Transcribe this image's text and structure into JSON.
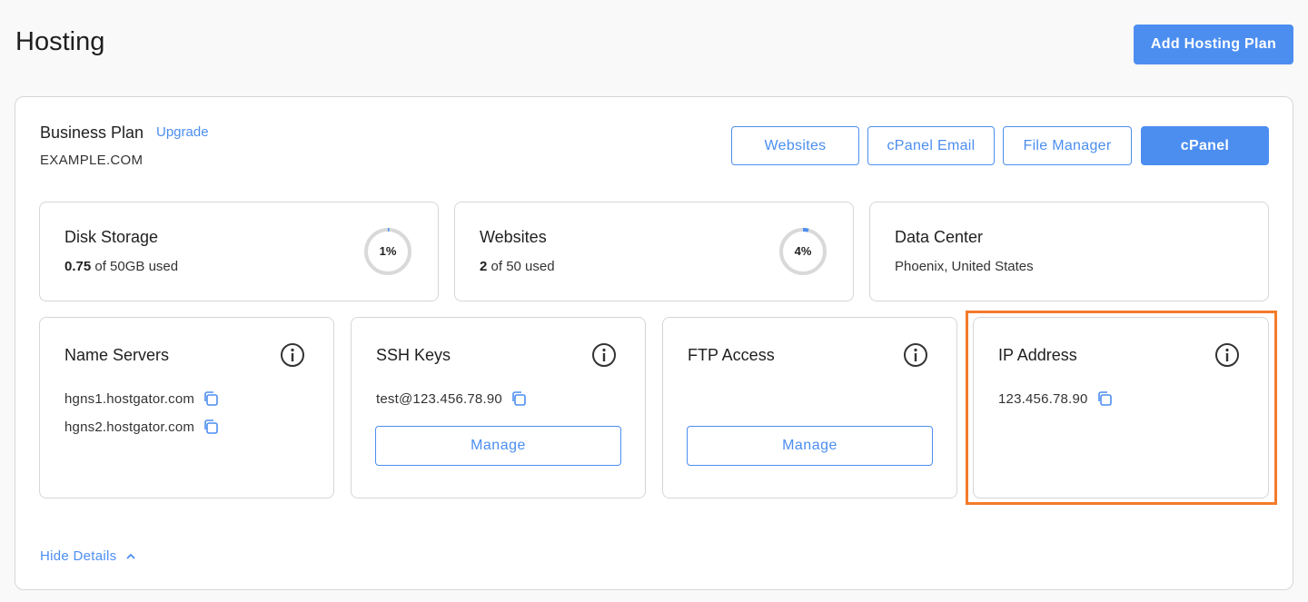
{
  "header": {
    "title": "Hosting",
    "add_button": "Add Hosting Plan"
  },
  "plan": {
    "name": "Business Plan",
    "upgrade": "Upgrade",
    "domain": "EXAMPLE.COM",
    "buttons": {
      "websites": "Websites",
      "cpanel_email": "cPanel Email",
      "file_manager": "File Manager",
      "cpanel": "cPanel"
    }
  },
  "stats": {
    "disk": {
      "title": "Disk Storage",
      "used": "0.75",
      "rest": "of 50GB used",
      "percent": "1%",
      "fraction": 0.01
    },
    "websites": {
      "title": "Websites",
      "used": "2",
      "rest": "of 50 used",
      "percent": "4%",
      "fraction": 0.04
    },
    "datacenter": {
      "title": "Data Center",
      "location": "Phoenix, United States"
    }
  },
  "details": {
    "nameservers": {
      "title": "Name Servers",
      "ns1": "hgns1.hostgator.com",
      "ns2": "hgns2.hostgator.com"
    },
    "ssh": {
      "title": "SSH Keys",
      "key": "test@123.456.78.90",
      "manage": "Manage"
    },
    "ftp": {
      "title": "FTP Access",
      "manage": "Manage"
    },
    "ip": {
      "title": "IP Address",
      "address": "123.456.78.90"
    }
  },
  "footer": {
    "hide_details": "Hide Details"
  },
  "colors": {
    "accent": "#4c8ef0",
    "highlight": "#f47b2a",
    "ring_track": "#d9d9d9"
  }
}
